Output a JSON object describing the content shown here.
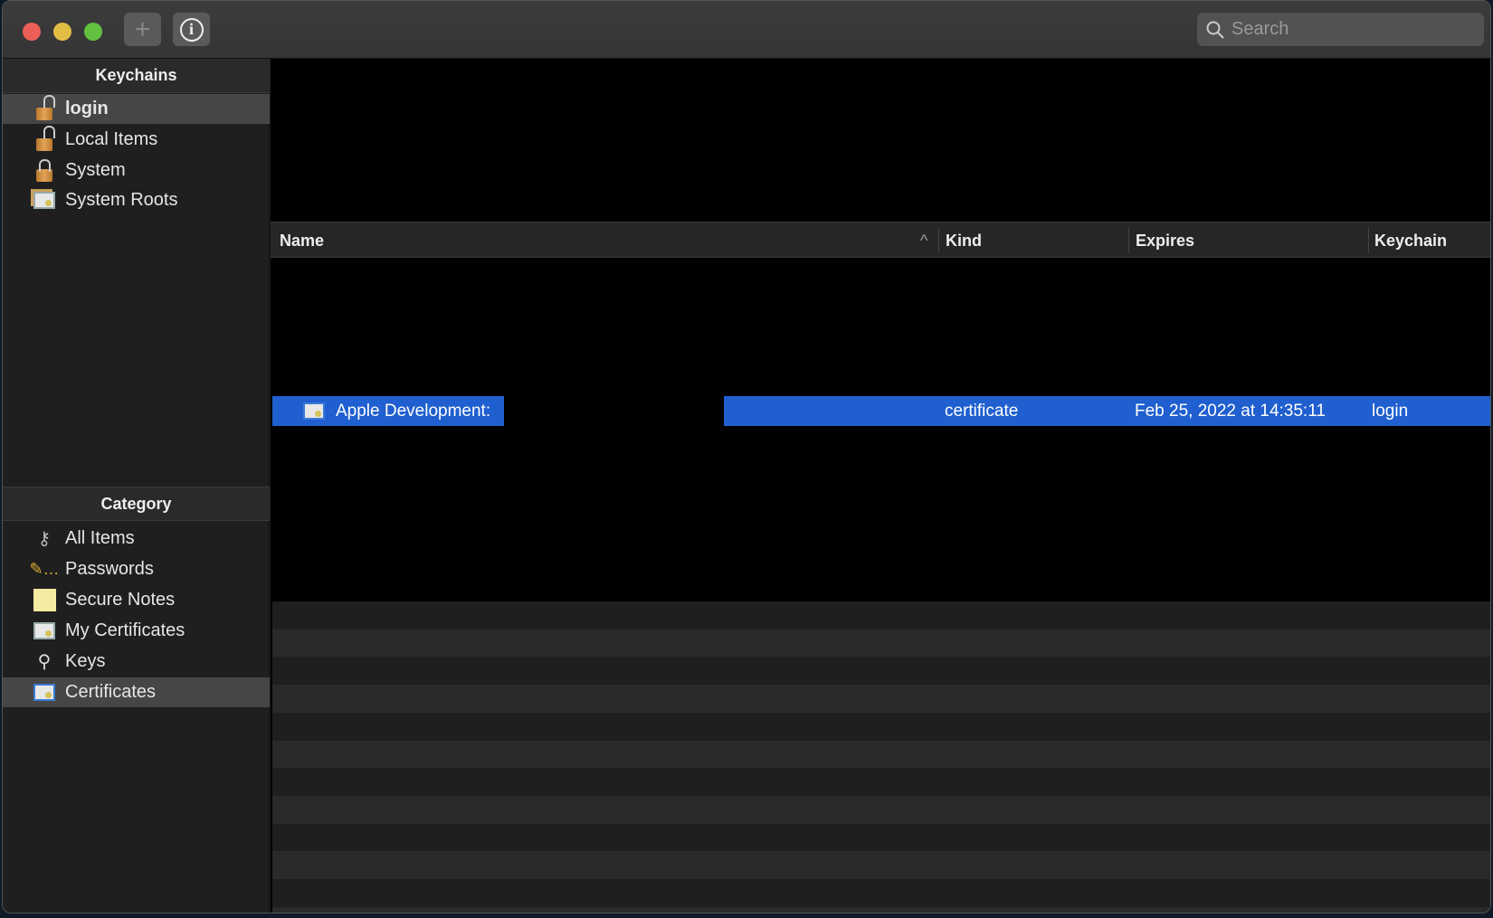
{
  "toolbar": {
    "add_label": "+",
    "info_label": "i",
    "search_placeholder": "Search"
  },
  "sidebar": {
    "keychains_header": "Keychains",
    "keychains": [
      {
        "label": "login",
        "icon": "unlocked-padlock-icon"
      },
      {
        "label": "Local Items",
        "icon": "unlocked-padlock-icon"
      },
      {
        "label": "System",
        "icon": "locked-padlock-icon"
      },
      {
        "label": "System Roots",
        "icon": "certificates-stack-icon"
      }
    ],
    "category_header": "Category",
    "categories": [
      {
        "label": "All Items",
        "icon": "keys-icon"
      },
      {
        "label": "Passwords",
        "icon": "pencil-icon"
      },
      {
        "label": "Secure Notes",
        "icon": "note-icon"
      },
      {
        "label": "My Certificates",
        "icon": "my-certificate-icon"
      },
      {
        "label": "Keys",
        "icon": "key-icon"
      },
      {
        "label": "Certificates",
        "icon": "certificate-icon"
      }
    ]
  },
  "table": {
    "columns": {
      "name": "Name",
      "kind": "Kind",
      "expires": "Expires",
      "keychain": "Keychain"
    },
    "sort_indicator": "^",
    "rows": [
      {
        "name": "Apple Development:",
        "kind": "certificate",
        "expires": "Feb 25, 2022 at 14:35:11",
        "keychain": "login"
      }
    ]
  },
  "colors": {
    "selection": "#1f5fcf",
    "sidebar_selection": "#464646"
  }
}
